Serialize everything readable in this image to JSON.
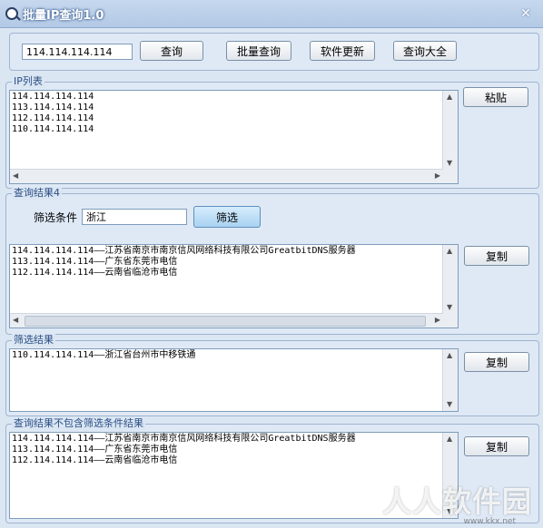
{
  "window": {
    "title": "批量IP查询1.0",
    "close_glyph": "✕"
  },
  "toolbar": {
    "ip_value": "114.114.114.114",
    "query_label": "查询",
    "batch_query_label": "批量查询",
    "update_label": "软件更新",
    "query_all_label": "查询大全"
  },
  "ip_list": {
    "label": "IP列表",
    "text": "114.114.114.114\n113.114.114.114\n112.114.114.114\n110.114.114.114",
    "paste_label": "粘贴"
  },
  "results": {
    "label": "查询结果4",
    "filter_label": "筛选条件",
    "filter_value": "浙江",
    "filter_button": "筛选",
    "text": "114.114.114.114——江苏省南京市南京信风网络科技有限公司GreatbitDNS服务器\n113.114.114.114——广东省东莞市电信\n112.114.114.114——云南省临沧市电信",
    "copy_label": "复制"
  },
  "filtered": {
    "label": "筛选结果",
    "text": "110.114.114.114——浙江省台州市中移铁通",
    "copy_label": "复制"
  },
  "excluded": {
    "label": "查询结果不包含筛选条件结果",
    "text": "114.114.114.114——江苏省南京市南京信风网络科技有限公司GreatbitDNS服务器\n113.114.114.114——广东省东莞市电信\n112.114.114.114——云南省临沧市电信",
    "copy_label": "复制"
  },
  "watermark": {
    "text": "人人软件园",
    "sub": "www.kkx.net"
  },
  "icons": {
    "app": "magnifier-icon",
    "close": "close-icon"
  }
}
